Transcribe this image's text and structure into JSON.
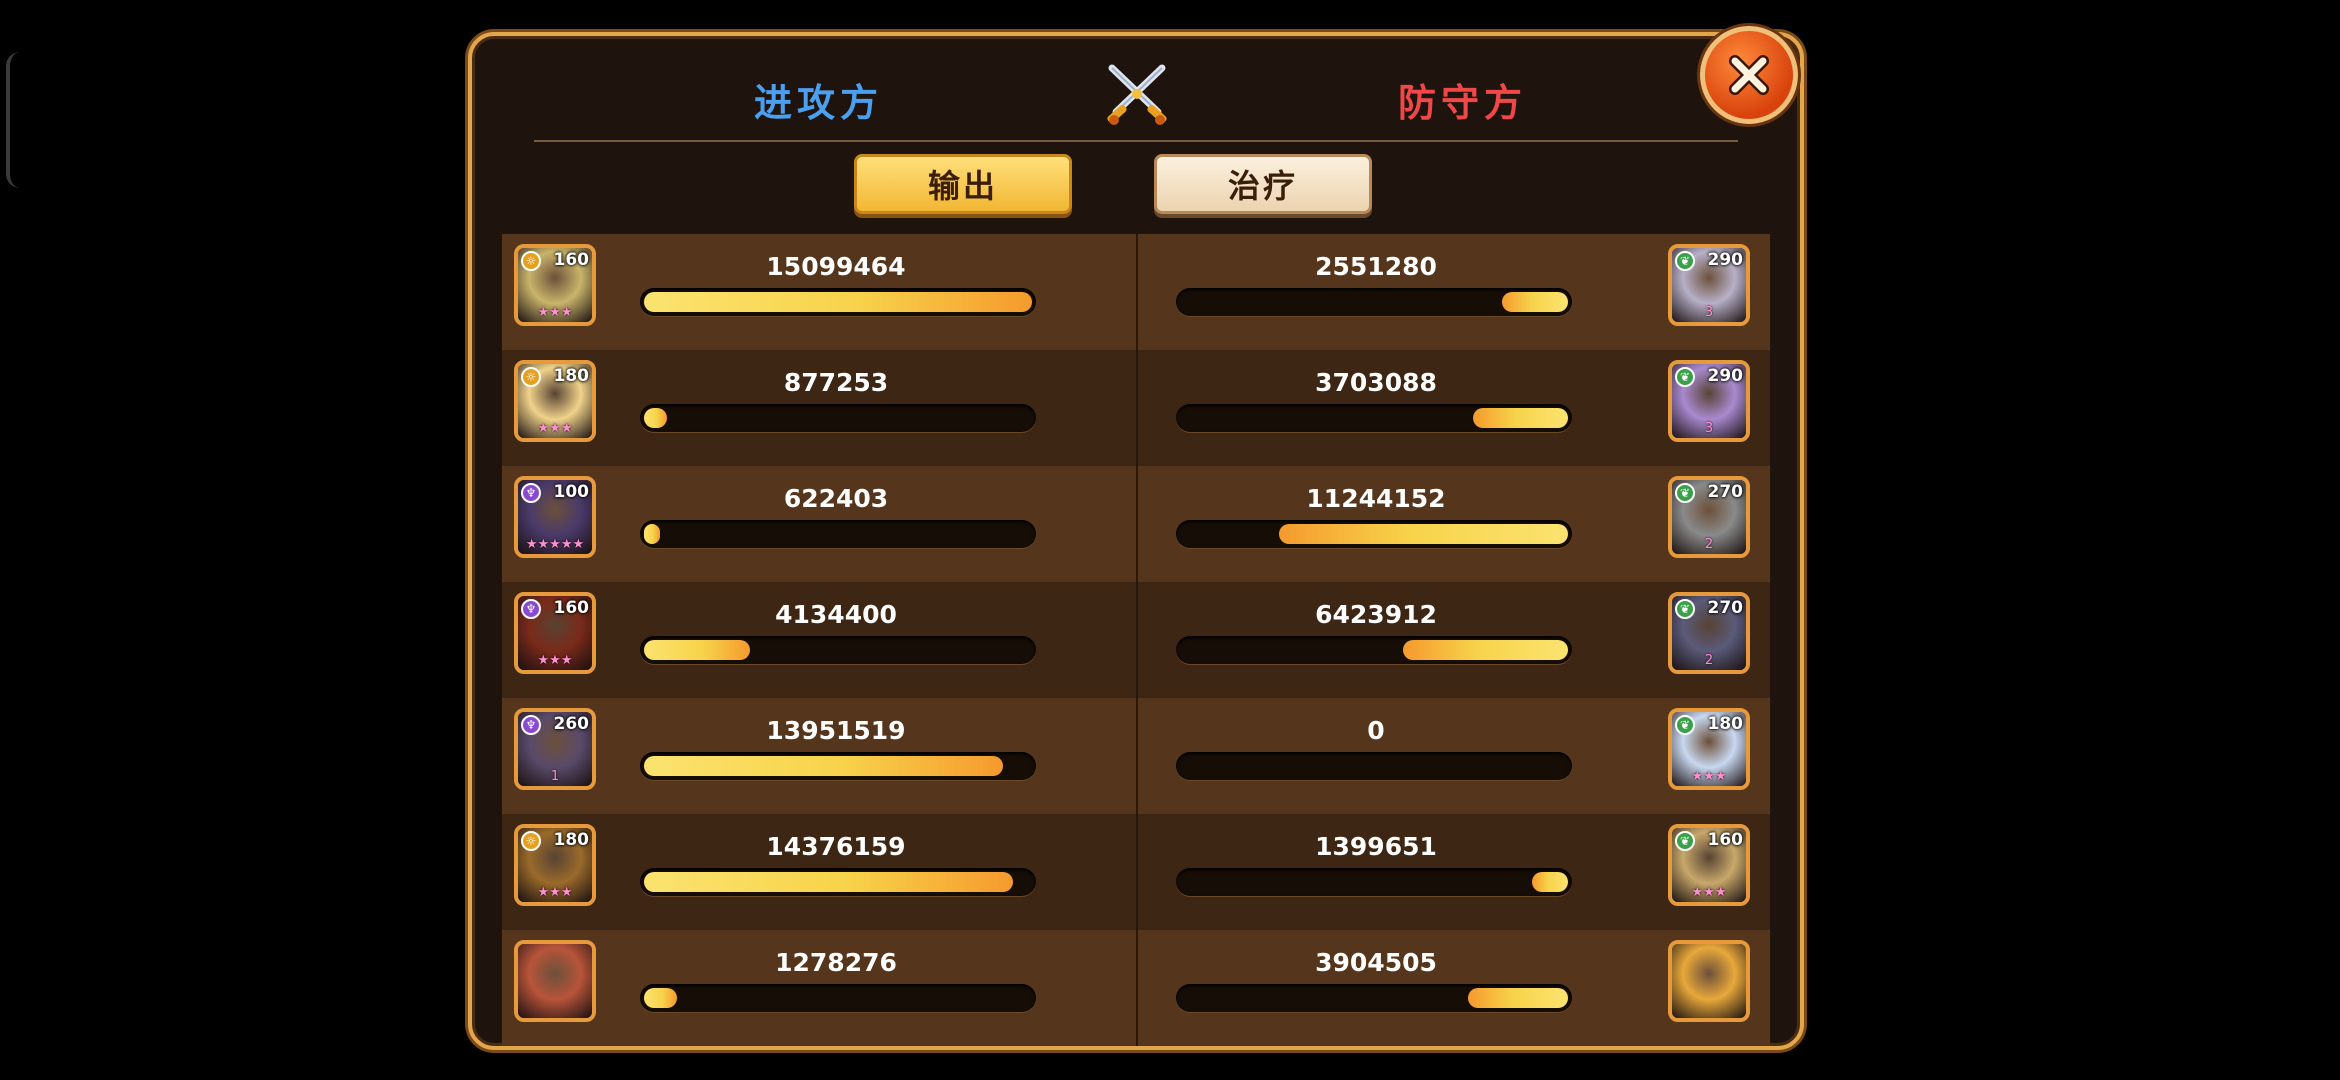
{
  "header": {
    "attacker_label": "进攻方",
    "defender_label": "防守方"
  },
  "tabs": {
    "output_label": "输出",
    "heal_label": "治疗"
  },
  "max_value": 15099464,
  "rows": [
    {
      "attacker": {
        "level": "160",
        "element": "gold",
        "stars": "★★★",
        "value": "15099464",
        "ratio": 1.0,
        "color": "#c9b46a"
      },
      "defender": {
        "level": "290",
        "element": "green",
        "stars": "3",
        "value": "2551280",
        "ratio": 0.169,
        "color": "#b7b0c8"
      }
    },
    {
      "attacker": {
        "level": "180",
        "element": "gold",
        "stars": "★★★",
        "value": "877253",
        "ratio": 0.058,
        "color": "#f0d28a"
      },
      "defender": {
        "level": "290",
        "element": "green",
        "stars": "3",
        "value": "3703088",
        "ratio": 0.245,
        "color": "#a98ad0"
      }
    },
    {
      "attacker": {
        "level": "100",
        "element": "purple",
        "stars": "★★★★★",
        "value": "622403",
        "ratio": 0.041,
        "color": "#4a3a6a"
      },
      "defender": {
        "level": "270",
        "element": "green",
        "stars": "2",
        "value": "11244152",
        "ratio": 0.745,
        "color": "#8a8a8a"
      }
    },
    {
      "attacker": {
        "level": "160",
        "element": "purple",
        "stars": "★★★",
        "value": "4134400",
        "ratio": 0.274,
        "color": "#7a2a1a"
      },
      "defender": {
        "level": "270",
        "element": "green",
        "stars": "2",
        "value": "6423912",
        "ratio": 0.425,
        "color": "#5a5a7a"
      }
    },
    {
      "attacker": {
        "level": "260",
        "element": "purple",
        "stars": "1",
        "value": "13951519",
        "ratio": 0.924,
        "color": "#5a4a6a"
      },
      "defender": {
        "level": "180",
        "element": "green",
        "stars": "★★★",
        "value": "0",
        "ratio": 0.0,
        "color": "#c8d8f0"
      }
    },
    {
      "attacker": {
        "level": "180",
        "element": "gold",
        "stars": "★★★",
        "value": "14376159",
        "ratio": 0.952,
        "color": "#9a6a2a"
      },
      "defender": {
        "level": "160",
        "element": "green",
        "stars": "★★★",
        "value": "1399651",
        "ratio": 0.093,
        "color": "#c8a86a"
      }
    },
    {
      "attacker": {
        "level": "",
        "element": "",
        "stars": "",
        "value": "1278276",
        "ratio": 0.085,
        "color": "#b8543a"
      },
      "defender": {
        "level": "",
        "element": "",
        "stars": "",
        "value": "3904505",
        "ratio": 0.259,
        "color": "#e8a83a"
      }
    }
  ],
  "icons": {
    "swords": "crossed-swords-icon",
    "close": "close-icon"
  }
}
